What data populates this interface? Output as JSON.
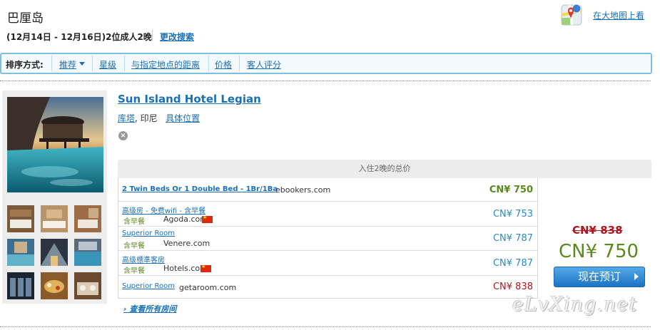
{
  "header": {
    "destination": "巴厘岛",
    "search_summary": "(12月14日 - 12月16日)2位成人2晚",
    "change_search_label": "更改搜索",
    "map_link_label": "在大地图上看"
  },
  "sort": {
    "label": "排序方式:",
    "options": [
      {
        "label": "推荐",
        "active": true
      },
      {
        "label": "星级"
      },
      {
        "label": "与指定地点的距离"
      },
      {
        "label": "价格"
      },
      {
        "label": "客人评分"
      }
    ]
  },
  "hotel": {
    "name": "Sun Island Hotel Legian",
    "city": "库塔",
    "country": ", 印尼",
    "location_link": "具体位置",
    "rates_header": "入住2晚的总价",
    "rates": [
      {
        "room": "2 Twin Beds Or 1 Double Bed - 1Br/1Ba",
        "meal": "",
        "site": "ebookers.com",
        "price": "CN¥ 750"
      },
      {
        "room": "高级房 - 免费wifi - 含早餐",
        "meal": "含早餐",
        "site": "Agoda.com",
        "price": "CN¥ 753"
      },
      {
        "room": "Superior Room",
        "meal": "含早餐",
        "site": "Venere.com",
        "price": "CN¥ 787"
      },
      {
        "room": "高级標準客房",
        "meal": "含早餐",
        "site": "Hotels.com",
        "price": "CN¥ 787"
      },
      {
        "room": "Superior Room",
        "meal": "",
        "site": "getaroom.com",
        "price": "CN¥ 838"
      }
    ],
    "old_price": "CN¥ 838",
    "best_price": "CN¥ 750",
    "book_label": "现在预订",
    "all_rooms_label": "查看所有房间"
  },
  "watermark": "eLvXing.net",
  "colors": {
    "link": "#1a6fb5",
    "best_price": "#5a8a1d",
    "strike_price": "#b0181e",
    "sortbar_border": "#7cc0e4"
  }
}
